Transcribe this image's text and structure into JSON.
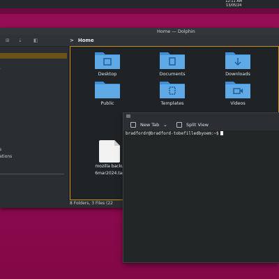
{
  "panel": {
    "time": "12:11 AM",
    "date": "13/05/24"
  },
  "dolphin": {
    "window_title": "Home — Dolphin",
    "breadcrumb": "Home",
    "status": "8 Folders, 3 Files (22",
    "sidebar_fragments": [
      "s",
      "ations"
    ],
    "folders": [
      {
        "label": "Desktop",
        "icon": "desktop-folder-icon"
      },
      {
        "label": "Documents",
        "icon": "documents-folder-icon"
      },
      {
        "label": "Downloads",
        "icon": "downloads-folder-icon"
      },
      {
        "label": "Public",
        "icon": "public-folder-icon"
      },
      {
        "label": "Templates",
        "icon": "templates-folder-icon"
      },
      {
        "label": "Videos",
        "icon": "videos-folder-icon"
      }
    ],
    "file": {
      "line1": "mozilla backu",
      "line2": "6mar2024.tar"
    },
    "folder_color": "#5fa9e6",
    "selection_color": "#c98a1a"
  },
  "konsole": {
    "new_tab": "New Tab",
    "split_view": "Split View",
    "prompt": "bradfordr@bradford-tobefilledbyoem:~$"
  }
}
